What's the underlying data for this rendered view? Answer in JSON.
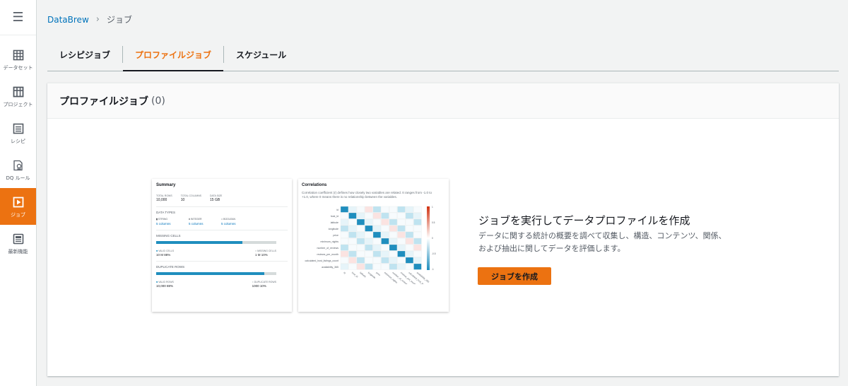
{
  "nav": {
    "items": [
      {
        "label": "データセット",
        "icon": "table-icon"
      },
      {
        "label": "プロジェクト",
        "icon": "grid-icon"
      },
      {
        "label": "レシピ",
        "icon": "list-icon"
      },
      {
        "label": "DQ ルール",
        "icon": "ruleset-icon"
      },
      {
        "label": "ジョブ",
        "icon": "play-icon"
      },
      {
        "label": "最新機能",
        "icon": "news-icon"
      }
    ],
    "active_index": 4
  },
  "breadcrumb": {
    "root": "DataBrew",
    "current": "ジョブ"
  },
  "tabs": [
    {
      "label": "レシピジョブ"
    },
    {
      "label": "プロファイルジョブ"
    },
    {
      "label": "スケジュール"
    }
  ],
  "panel": {
    "title": "プロファイルジョブ",
    "count": "(0)"
  },
  "summary_card": {
    "title": "Summary",
    "stats": [
      {
        "label": "TOTAL ROWS",
        "value": "10,000"
      },
      {
        "label": "TOTAL COLUMNS",
        "value": "10"
      },
      {
        "label": "DATA SIZE",
        "value": "15 GB"
      }
    ],
    "data_types_title": "DATA TYPES",
    "types": [
      {
        "label": "STRING",
        "value": "5 columns"
      },
      {
        "label": "INTEGER",
        "value": "5 columns"
      },
      {
        "label": "BOOLEAN",
        "value": "5 columns"
      }
    ],
    "missing_title": "MISSING CELLS",
    "missing_fill": 0.72,
    "valid_cells": {
      "label": "VALID CELLS",
      "value": "10 M  88%"
    },
    "missing_cells": {
      "label": "MISSING CELLS",
      "value": "1 M  10%"
    },
    "duplicate_title": "DUPLICATE ROWS",
    "duplicate_fill": 0.9,
    "valid_rows": {
      "label": "VALID ROWS",
      "value": "10,000  88%"
    },
    "duplicate_rows": {
      "label": "DUPLICATE ROWS",
      "value": "1000  10%"
    }
  },
  "corr_card": {
    "title": "Correlations",
    "desc": "Correlation coefficient (r) defines how closely two variables are related. It ranges from -1.0 to +1.0, where 0 means there is no relationship between the variables.",
    "variables": [
      "id",
      "host_id",
      "latitude",
      "longitude",
      "price",
      "minimum_nights",
      "number_of_reviews",
      "reviews_per_month",
      "calculated_host_listings_count",
      "availability_365"
    ],
    "scale": [
      "1",
      "0.5",
      "0",
      "-0.5",
      "-1"
    ]
  },
  "empty_state": {
    "title": "ジョブを実行してデータプロファイルを作成",
    "line1": "データに関する統計の概要を調べて収集し、構造、コンテンツ、関係、",
    "line2": "および抽出に関してデータを評価します。",
    "button": "ジョブを作成"
  },
  "colors": {
    "accent": "#ec7211",
    "link": "#0073bb",
    "bar": "#1f8ebe"
  }
}
